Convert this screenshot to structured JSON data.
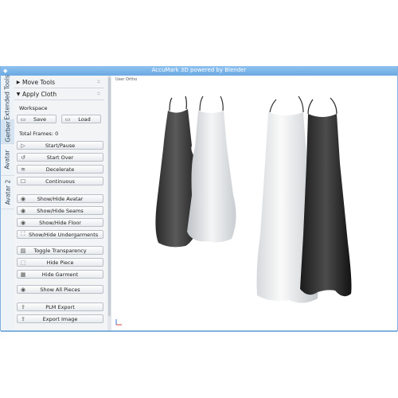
{
  "window": {
    "title": "AccuMark 3D powered by Blender"
  },
  "vtabs": [
    "Extended Tools",
    "Gerber",
    "Avatar",
    "Avatar 2"
  ],
  "panel": {
    "move_tools": "Move Tools",
    "apply_cloth": "Apply Cloth",
    "workspace_label": "Workspace",
    "save": "Save",
    "load": "Load",
    "total_frames": "Total Frames: 0",
    "buttons": [
      "Start/Pause",
      "Start Over",
      "Decelerate",
      "Continuous",
      "Show/Hide Avatar",
      "Show/Hide Seams",
      "Show/Hide Floor",
      "Show/Hide Undergarments",
      "Toggle Transparency",
      "Hide Piece",
      "Hide Garment",
      "Show All Pieces",
      "PLM Export",
      "Export Image"
    ]
  },
  "viewport": {
    "label": "User Ortho"
  },
  "colors": {
    "title_bar": "#6aa9e3",
    "panel_bg": "#f2f4f6"
  }
}
